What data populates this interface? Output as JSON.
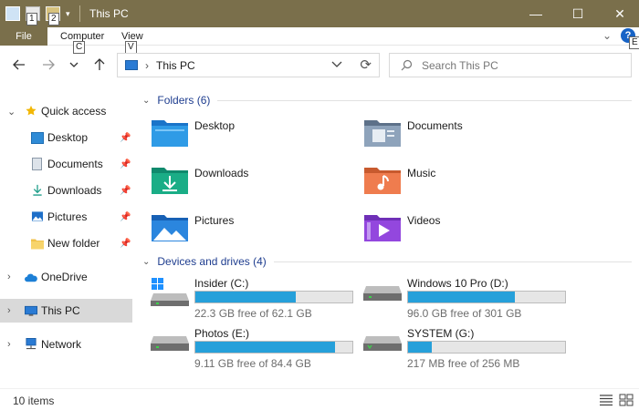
{
  "window": {
    "title": "This PC",
    "qat_keytips": [
      "1",
      "2"
    ],
    "minimize_icon": "—",
    "maximize_icon": "☐",
    "close_icon": "✕"
  },
  "ribbon": {
    "tabs": [
      {
        "label": "File"
      },
      {
        "label": "Computer",
        "keytip": "C"
      },
      {
        "label": "View",
        "keytip": "V"
      }
    ],
    "help_keytip": "E",
    "help_glyph": "?"
  },
  "address": {
    "crumb": "This PC",
    "search_placeholder": "Search This PC"
  },
  "navpane": {
    "items": [
      {
        "label": "Quick access"
      },
      {
        "label": "Desktop"
      },
      {
        "label": "Documents"
      },
      {
        "label": "Downloads"
      },
      {
        "label": "Pictures"
      },
      {
        "label": "New folder"
      },
      {
        "label": "OneDrive"
      },
      {
        "label": "This PC",
        "selected": true
      },
      {
        "label": "Network"
      }
    ]
  },
  "content": {
    "folders_heading": "Folders (6)",
    "folders": [
      {
        "label": "Desktop"
      },
      {
        "label": "Documents"
      },
      {
        "label": "Downloads"
      },
      {
        "label": "Music"
      },
      {
        "label": "Pictures"
      },
      {
        "label": "Videos"
      }
    ],
    "drives_heading": "Devices and drives (4)",
    "drives": [
      {
        "name": "Insider (C:)",
        "status": "22.3 GB free of 62.1 GB",
        "used_fraction": 0.64
      },
      {
        "name": "Windows 10 Pro (D:)",
        "status": "96.0 GB free of 301 GB",
        "used_fraction": 0.68
      },
      {
        "name": "Photos (E:)",
        "status": "9.11 GB free of 84.4 GB",
        "used_fraction": 0.89
      },
      {
        "name": "SYSTEM (G:)",
        "status": "217 MB free of 256 MB",
        "used_fraction": 0.15
      }
    ]
  },
  "status": {
    "item_count": "10 items"
  },
  "colors": {
    "titlebar": "#7a6f4b",
    "drive_bar": "#26a0da",
    "group_heading": "#1e3d8f"
  }
}
